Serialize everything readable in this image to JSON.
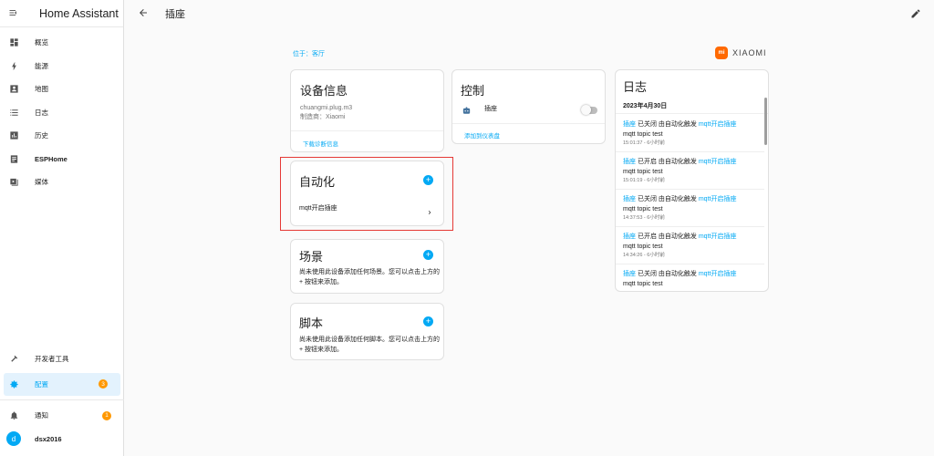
{
  "app": {
    "title": "Home Assistant"
  },
  "header": {
    "title": "插座"
  },
  "sidebar": {
    "items": [
      {
        "label": "概览",
        "icon": "dashboard-icon"
      },
      {
        "label": "能源",
        "icon": "lightning-icon"
      },
      {
        "label": "地图",
        "icon": "map-icon"
      },
      {
        "label": "日志",
        "icon": "list-icon"
      },
      {
        "label": "历史",
        "icon": "chart-icon"
      },
      {
        "label": "ESPHome",
        "icon": "esphome-icon"
      },
      {
        "label": "媒体",
        "icon": "media-icon"
      }
    ],
    "dev_tools": "开发者工具",
    "config": {
      "label": "配置",
      "badge": "3"
    },
    "notifications": {
      "label": "通知",
      "badge": "1"
    },
    "user": {
      "name": "dsx2016",
      "initial": "d"
    }
  },
  "location": "位于：客厅",
  "brand": "XIAOMI",
  "device_info": {
    "title": "设备信息",
    "model": "chuangmi.plug.m3",
    "manufacturer": "制造商：Xiaomi",
    "link": "下载诊断信息"
  },
  "control": {
    "title": "控制",
    "entity": "插座",
    "link": "添加到仪表盘"
  },
  "automation": {
    "title": "自动化",
    "item": "mqtt开启插座"
  },
  "scene": {
    "title": "场景",
    "desc": "尚未使用此设备添加任何场景。您可以点击上方的 + 按钮来添加。"
  },
  "script": {
    "title": "脚本",
    "desc": "尚未使用此设备添加任何脚本。您可以点击上方的 + 按钮来添加。"
  },
  "logbook": {
    "title": "日志",
    "date": "2023年4月30日",
    "entries": [
      {
        "entity": "插座",
        "action": " 已关闭 由自动化触发 ",
        "automation": "mqtt开启插座",
        "detail": "mqtt topic test",
        "time": "15:01:37 - 6小时前"
      },
      {
        "entity": "插座",
        "action": " 已开启 由自动化触发 ",
        "automation": "mqtt开启插座",
        "detail": "mqtt topic test",
        "time": "15:01:19 - 6小时前"
      },
      {
        "entity": "插座",
        "action": " 已关闭 由自动化触发 ",
        "automation": "mqtt开启插座",
        "detail": "mqtt topic test",
        "time": "14:37:53 - 6小时前"
      },
      {
        "entity": "插座",
        "action": " 已开启 由自动化触发 ",
        "automation": "mqtt开启插座",
        "detail": "mqtt topic test",
        "time": "14:34:26 - 6小时前"
      },
      {
        "entity": "插座",
        "action": " 已关闭 由自动化触发 ",
        "automation": "mqtt开启插座",
        "detail": "mqtt topic test",
        "time": ""
      }
    ]
  },
  "colors": {
    "accent": "#03a9f4",
    "badge": "#ff9800",
    "highlight": "#e53935",
    "brand": "#ff6900"
  }
}
